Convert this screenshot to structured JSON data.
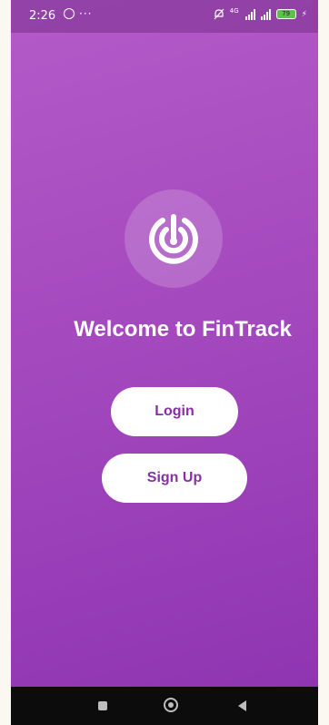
{
  "status_bar": {
    "time": "2:26",
    "network_label": "4G",
    "battery_level": "79"
  },
  "welcome": {
    "title": "Welcome to FinTrack"
  },
  "actions": {
    "login_label": "Login",
    "signup_label": "Sign Up"
  },
  "colors": {
    "gradient_top": "#b45ac8",
    "gradient_bottom": "#8e33b0",
    "button_bg": "#ffffff",
    "button_text": "#8a2da8"
  },
  "icons": {
    "logo": "radar-icon",
    "status": [
      "whatsapp-icon",
      "more-dots-icon",
      "bell-off-icon",
      "signal-icon",
      "battery-icon",
      "charging-icon"
    ],
    "nav": [
      "recents-icon",
      "home-icon",
      "back-icon"
    ]
  }
}
